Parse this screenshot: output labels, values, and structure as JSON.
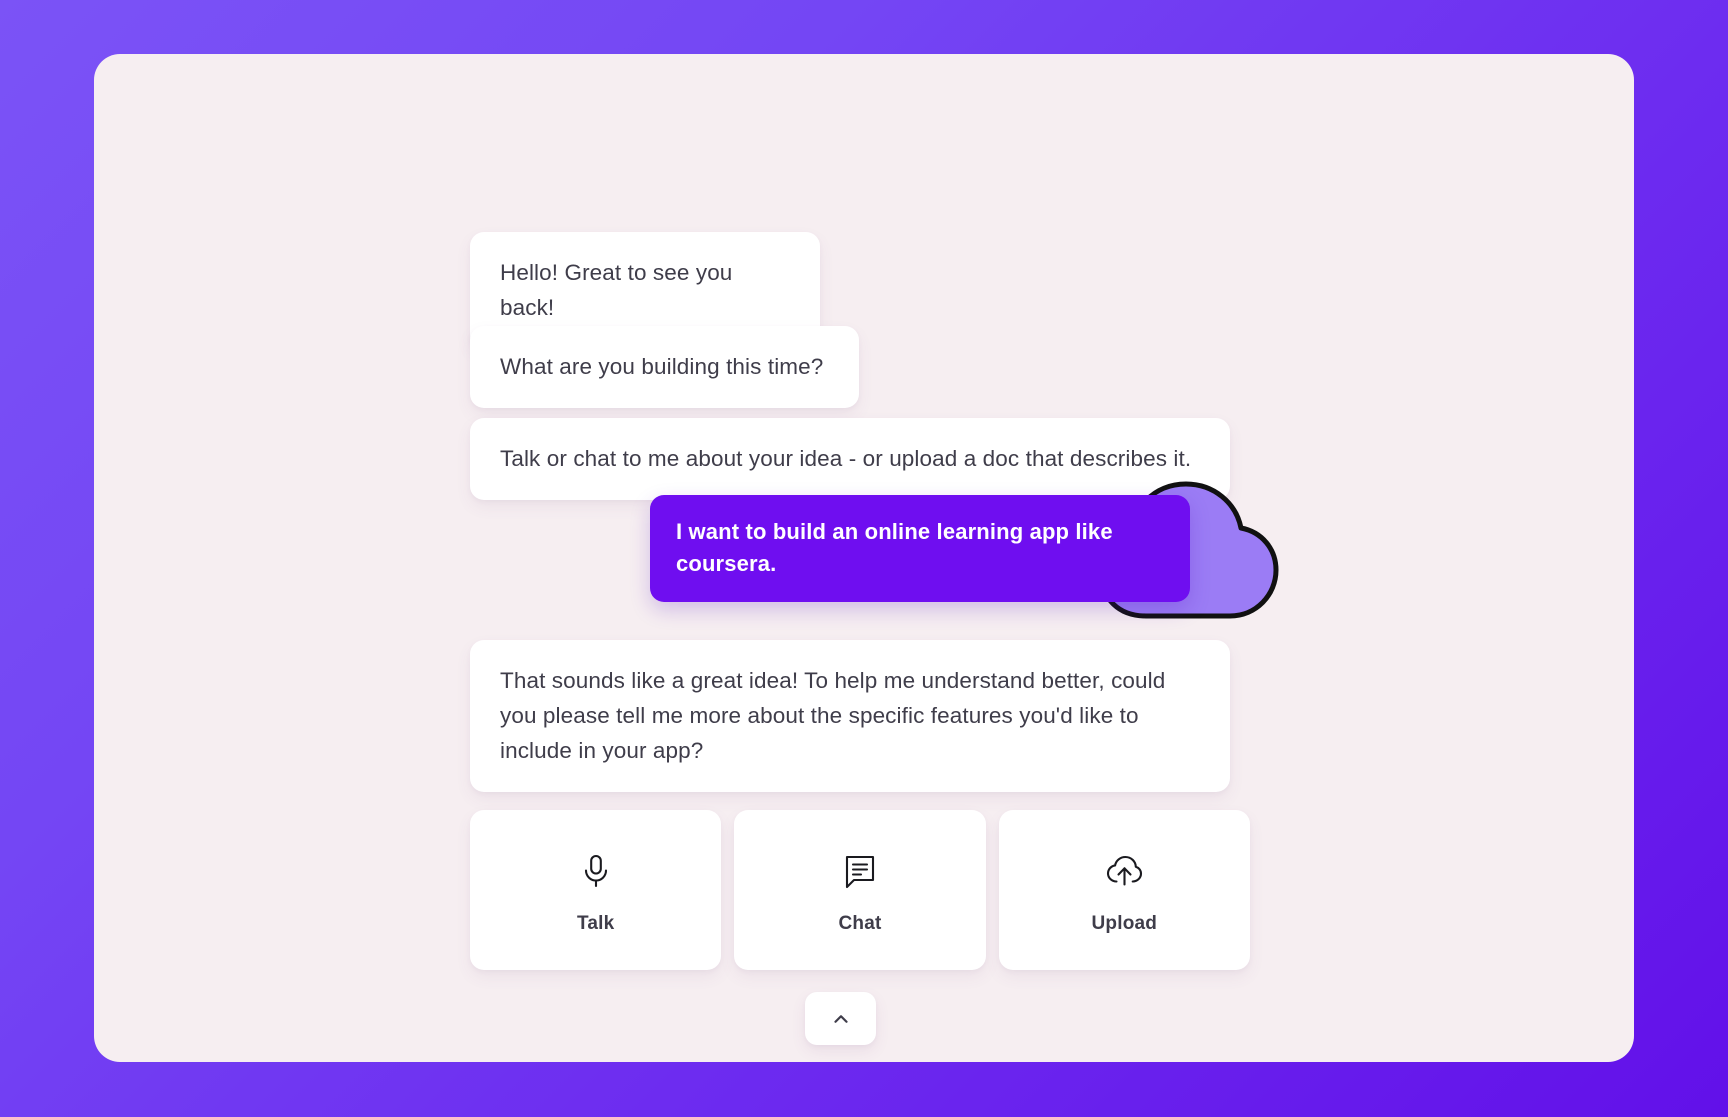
{
  "theme": {
    "background_gradient_start": "#7b53f6",
    "background_gradient_end": "#6210e9",
    "card_background": "#f6eef1",
    "bubble_ai_background": "#ffffff",
    "bubble_user_background": "#6f0ef0",
    "bubble_user_text": "#ffffff",
    "text_primary": "#3f3d4a",
    "decor_cloud_fill": "#9b7cf5",
    "decor_outline": "#111111"
  },
  "conversation": {
    "messages": [
      {
        "id": "greeting",
        "role": "assistant",
        "text": "Hello! Great to see you back!"
      },
      {
        "id": "question",
        "role": "assistant",
        "text": "What are you building this time?"
      },
      {
        "id": "instruction",
        "role": "assistant",
        "text": "Talk or chat to me about your idea - or upload a doc that describes it."
      },
      {
        "id": "user-idea",
        "role": "user",
        "text": "I want to build an online learning app like coursera."
      },
      {
        "id": "followup",
        "role": "assistant",
        "text": "That sounds like a great idea! To help me understand better, could you please tell me more about the specific features you'd like to include in your app?"
      }
    ]
  },
  "actions": {
    "buttons": [
      {
        "id": "talk",
        "label": "Talk",
        "icon": "microphone-icon"
      },
      {
        "id": "chat",
        "label": "Chat",
        "icon": "chat-bubble-icon"
      },
      {
        "id": "upload",
        "label": "Upload",
        "icon": "cloud-upload-icon"
      }
    ]
  },
  "collapse": {
    "icon": "chevron-up-icon"
  },
  "decorations": [
    {
      "id": "sun-arc",
      "icon": "sun-arc-icon"
    },
    {
      "id": "cloud-blob",
      "icon": "cloud-blob-icon"
    }
  ]
}
